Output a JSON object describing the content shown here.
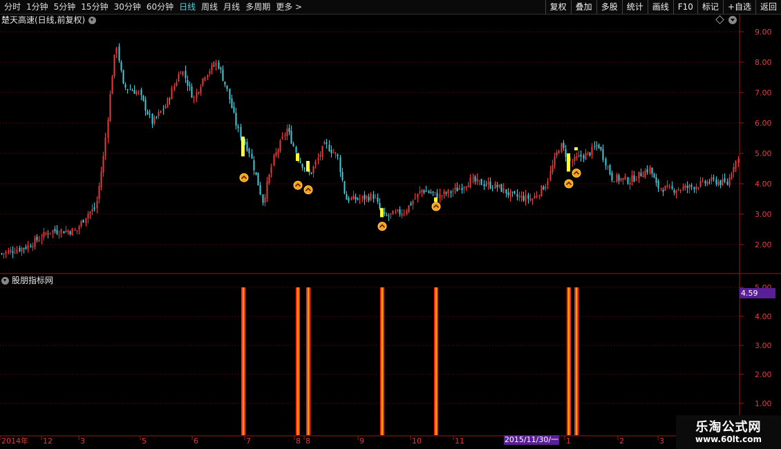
{
  "toolbar": {
    "periods": [
      "分时",
      "1分钟",
      "5分钟",
      "15分钟",
      "30分钟",
      "60分钟",
      "日线",
      "周线",
      "月线",
      "多周期",
      "更多"
    ],
    "active_period": "日线",
    "right_buttons": [
      "复权",
      "叠加",
      "多股",
      "统计",
      "画线",
      "F10",
      "标记",
      "+自选",
      "返回"
    ]
  },
  "chart": {
    "title": "楚天高速(日线,前复权)",
    "indicator_title": "股朋指标网",
    "price_ticks": [
      "9.00",
      "8.00",
      "7.00",
      "6.00",
      "5.00",
      "4.00",
      "3.00",
      "2.00"
    ],
    "indicator_ticks": [
      "5.00",
      "4.00",
      "3.00",
      "2.00",
      "1.00"
    ],
    "current_value": "4.59",
    "date_labels": [
      "2014年",
      "12",
      "3",
      "5",
      "6",
      "7",
      "8",
      "8",
      "9",
      "10",
      "11",
      "1",
      "2",
      "3"
    ],
    "cursor_date": "2015/11/30/一",
    "colors": {
      "up": "#e83b3b",
      "down": "#3fd0e0",
      "signal": "#ffff33",
      "bar_outer": "#ff2a1a",
      "bar_inner": "#ffaa00"
    }
  },
  "watermark": {
    "line1": "乐淘公式网",
    "line2": "www.60lt.com"
  }
}
